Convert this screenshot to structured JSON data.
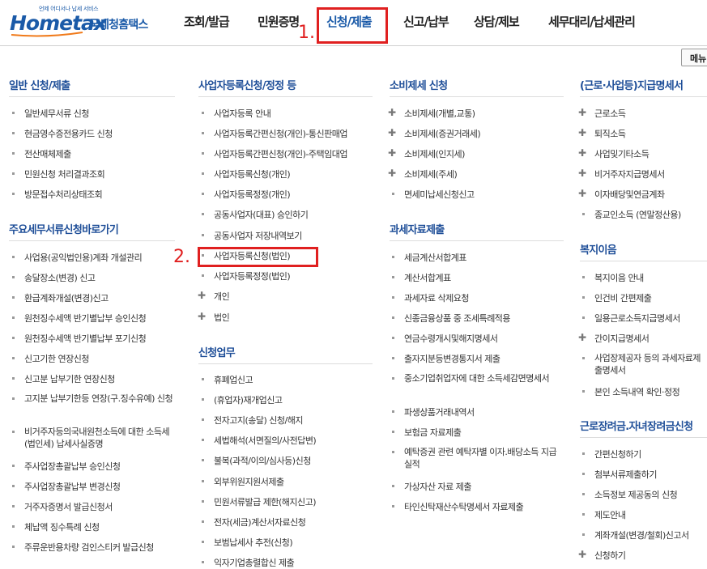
{
  "logo": {
    "tagline": "언제 어디서나 납세 서비스",
    "main": "Hometax",
    "sub": "국세청홈택스"
  },
  "nav": [
    "조회/발급",
    "민원증명",
    "신청/제출",
    "신고/납부",
    "상담/제보",
    "세무대리/납세관리"
  ],
  "annotations": {
    "one": "1.",
    "two": "2."
  },
  "menu_button": "메뉴",
  "col1": {
    "cat1": "일반 신청/제출",
    "items1": [
      "일반세무서류 신청",
      "현금영수증전용카드 신청",
      "전산매체제출",
      "민원신청 처리결과조회",
      "방문접수처리상태조회"
    ],
    "cat2": "주요세무서류신청바로가기",
    "items2": [
      "사업용(공익법인용)계좌 개설관리",
      "송달장소(변경) 신고",
      "환급계좌개설(변경)신고",
      "원천징수세액 반기별납부 승인신청",
      "원천징수세액 반기별납부 포기신청",
      "신고기한 연장신청",
      "신고분 납부기한 연장신청",
      "고지분 납부기한등 연장(구.징수유예) 신청",
      "비거주자등의국내원천소득에 대한 소득세(법인세) 납세사실증명",
      "주사업장총괄납부 승인신청",
      "주사업장총괄납부 변경신청",
      "거주자증명서 발급신청서",
      "체납액 징수특례 신청",
      "주류운반용차량 검인스티커 발급신청"
    ]
  },
  "col2": {
    "cat1": "사업자등록신청/정정 등",
    "items1": [
      "사업자등록 안내",
      "사업자등록간편신청(개인)-통신판매업",
      "사업자등록간편신청(개인)-주택임대업",
      "사업자등록신청(개인)",
      "사업자등록정정(개인)",
      "공동사업자(대표) 승인하기",
      "공동사업자 저장내역보기",
      "사업자등록신청(법인)",
      "사업자등록정정(법인)"
    ],
    "plus1": [
      "개인",
      "법인"
    ],
    "cat2": "신청업무",
    "items2": [
      "휴폐업신고",
      "(휴업자)재개업신고",
      "전자고지(송달) 신청/해지",
      "세법해석(서면질의/사전답변)",
      "불복(과적/이의/심사등)신청",
      "외부위원지원서제출",
      "민원서류발급 제한(해지신고)",
      "전자(세금)계산서자료신청",
      "보범납세사 추전(신청)",
      "익자기업총렬합신 제출"
    ]
  },
  "col3": {
    "cat1": "소비제세 신청",
    "plus1": [
      "소비제세(개별,교통)",
      "소비제세(증권거래세)",
      "소비제세(인지세)",
      "소비제세(주세)"
    ],
    "items1": [
      "면세미납세신청신고"
    ],
    "cat2": "과세자료제출",
    "items2": [
      "세금계산서합계표",
      "계산서합계표",
      "과세자료 삭제요청",
      "신종금융상품 중 조세특례적용",
      "연금수령개시및해지명세서",
      "출자지분등변경통지서 제출",
      "중소기업취업자에 대한 소득세감면명세서",
      "파생상품거래내역서",
      "보험금 자료제출",
      "예탁증권 관련 예탁자별 이자.배당소득 지급 실적",
      "가상자산 자료 제출",
      "타인신탁재산수탁명세서 자료제출"
    ]
  },
  "col4": {
    "cat1": "(근로·사업등)지급명세서",
    "plus1": [
      "근로소득",
      "퇴직소득",
      "사업및기타소득",
      "비거주자지급명세서",
      "이자배당및연금계좌"
    ],
    "items1": [
      "종교인소득 (연말정산용)"
    ],
    "cat2": "복지이음",
    "items2": [
      "복지이음 안내",
      "인건비 간편제출",
      "일용근로소득지급명세서"
    ],
    "plus2": [
      "간이지급명세서"
    ],
    "items2b": [
      "사업장제공자 등의 과세자료제출명세서",
      "본인 소득내역 확인·정정"
    ],
    "cat3": "근로장려금.자녀장려금신청",
    "items3": [
      "간편신청하기",
      "첨부서류제출하기",
      "소득정보 제공동의 신청",
      "제도안내",
      "계좌개설(변경/철회)신고서"
    ],
    "plus3": [
      "신청하기"
    ]
  }
}
